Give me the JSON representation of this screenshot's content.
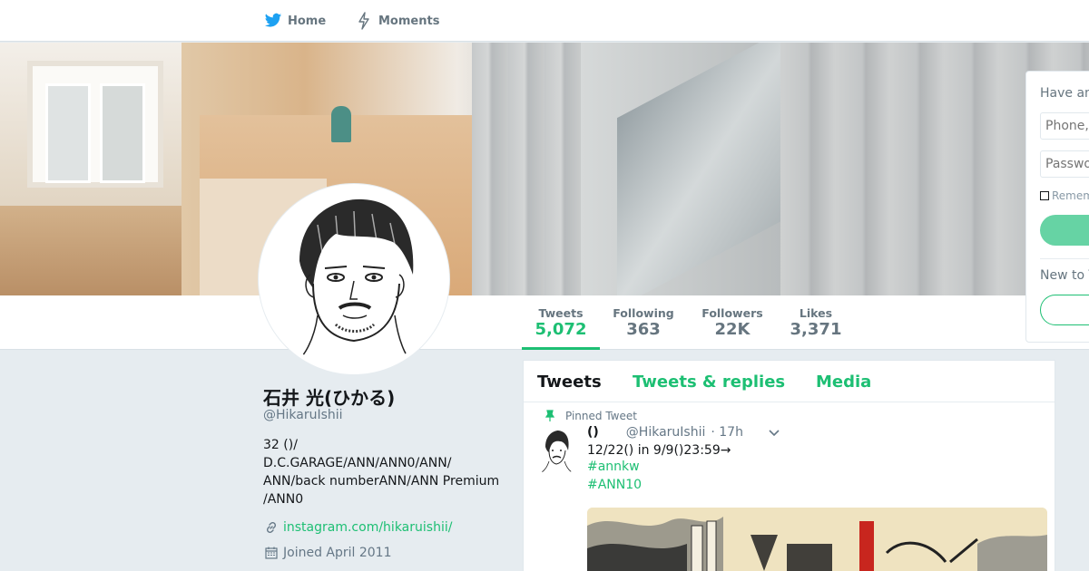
{
  "nav": {
    "home_label": "Home",
    "moments_label": "Moments",
    "home_icon": "twitter-bird-icon",
    "moments_icon": "lightning-icon"
  },
  "stats": [
    {
      "label": "Tweets",
      "value": "5,072",
      "active": true
    },
    {
      "label": "Following",
      "value": "363",
      "active": false
    },
    {
      "label": "Followers",
      "value": "22K",
      "active": false
    },
    {
      "label": "Likes",
      "value": "3,371",
      "active": false
    }
  ],
  "profile": {
    "name": "石井 光(ひかる)",
    "handle": "@HikaruIshii",
    "bio_lines": [
      "32 ()/",
      "D.C.GARAGE/ANN/ANN0/ANN/",
      "ANN/back numberANN/ANN Premium",
      "/ANN0"
    ],
    "link_text": "instagram.com/hikaruishii/",
    "joined_text": "Joined April 2011"
  },
  "timeline": {
    "tabs": [
      {
        "label": "Tweets",
        "active": true
      },
      {
        "label": "Tweets & replies",
        "active": false
      },
      {
        "label": "Media",
        "active": false
      }
    ],
    "pinned_label": "Pinned Tweet",
    "tweet": {
      "name": "()",
      "handle": "@HikaruIshii",
      "time": "· 17h",
      "text": "12/22()  in 9/9()23:59→",
      "hashtags": [
        "#annkw",
        "#ANN10"
      ]
    }
  },
  "login": {
    "header": "Have an account?",
    "phone_placeholder": "Phone, email or username",
    "password_placeholder": "Password",
    "remember_label": "Remember me",
    "new_label": "New to Twitter?"
  },
  "colors": {
    "accent": "#1dbf73",
    "accent_light": "#66d3a4",
    "muted": "#657786",
    "background": "#e6ecf0"
  }
}
